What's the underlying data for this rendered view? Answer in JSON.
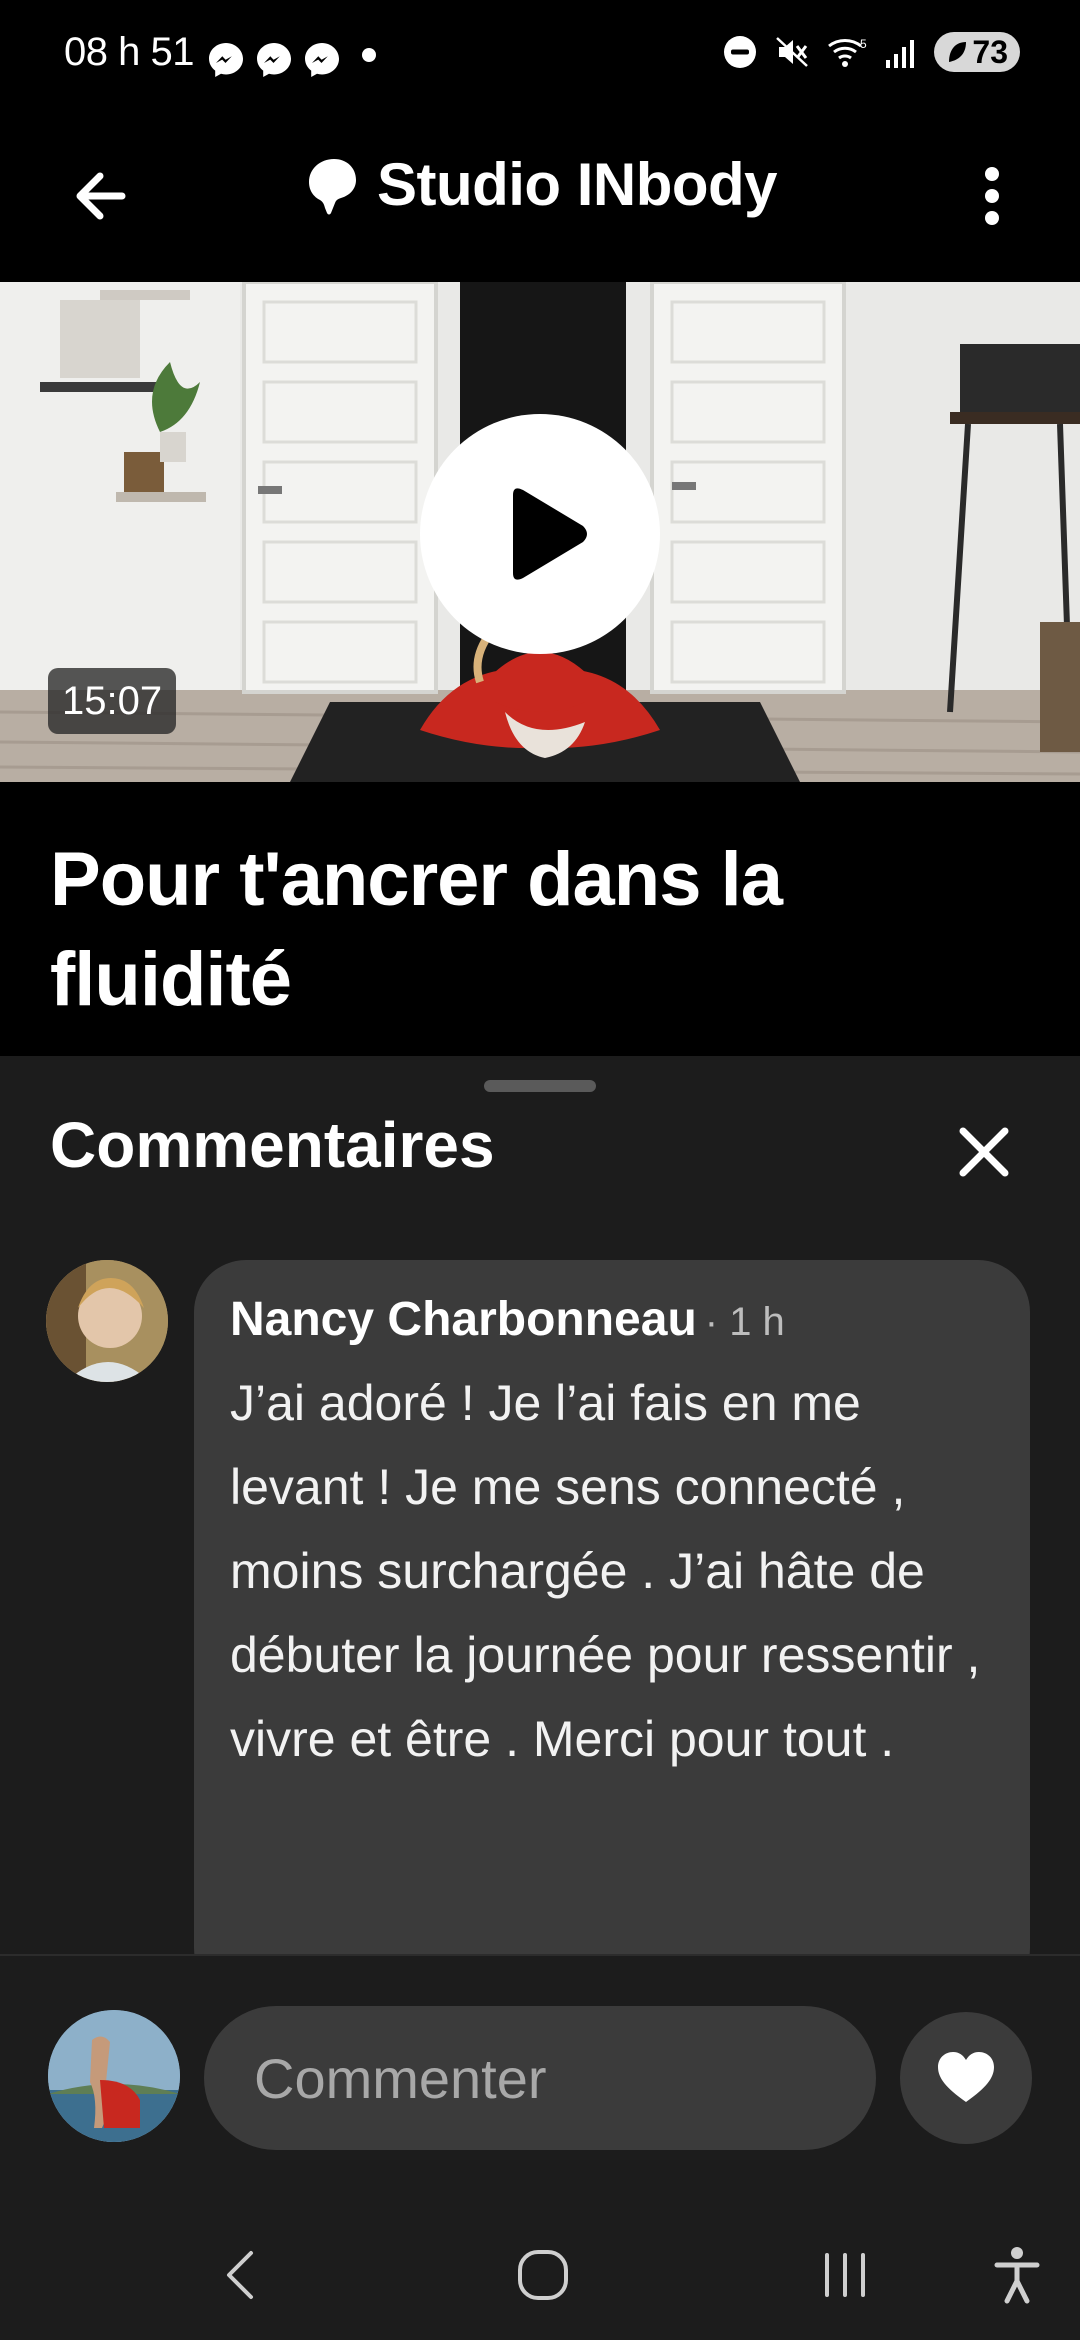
{
  "status_bar": {
    "time": "08 h 51",
    "battery": "73",
    "icons": [
      "messenger-icon",
      "messenger-icon",
      "messenger-icon",
      "dot-icon",
      "dnd-icon",
      "mute-icon",
      "wifi-icon",
      "signal-icon",
      "battery-icon"
    ]
  },
  "header": {
    "title": "Studio INbody",
    "back_icon": "arrow-left-icon",
    "logo_icon": "patreon-icon",
    "menu_icon": "more-vertical-icon"
  },
  "video": {
    "duration": "15:07",
    "play_icon": "play-icon"
  },
  "post": {
    "title": "Pour t'ancrer dans la fluidité"
  },
  "comments_panel": {
    "title": "Commentaires",
    "close_icon": "close-icon",
    "comments": [
      {
        "author": "Nancy Charbonneau",
        "time": "· 1 h",
        "text": "J’ai adoré ! Je l’ai fais en me levant ! Je me sens connecté , moins surchargée . J’ai hâte de débuter la journée pour ressentir , vivre et être . Merci pour tout ."
      }
    ]
  },
  "composer": {
    "placeholder": "Commenter",
    "like_icon": "heart-icon"
  },
  "nav_bar": {
    "buttons": [
      "back-nav-icon",
      "home-nav-icon",
      "recents-nav-icon",
      "accessibility-icon"
    ]
  },
  "colors": {
    "background": "#000000",
    "sheet": "#1c1c1c",
    "bubble": "#3b3b3b",
    "text": "#ffffff",
    "muted": "#bdbdbd"
  }
}
